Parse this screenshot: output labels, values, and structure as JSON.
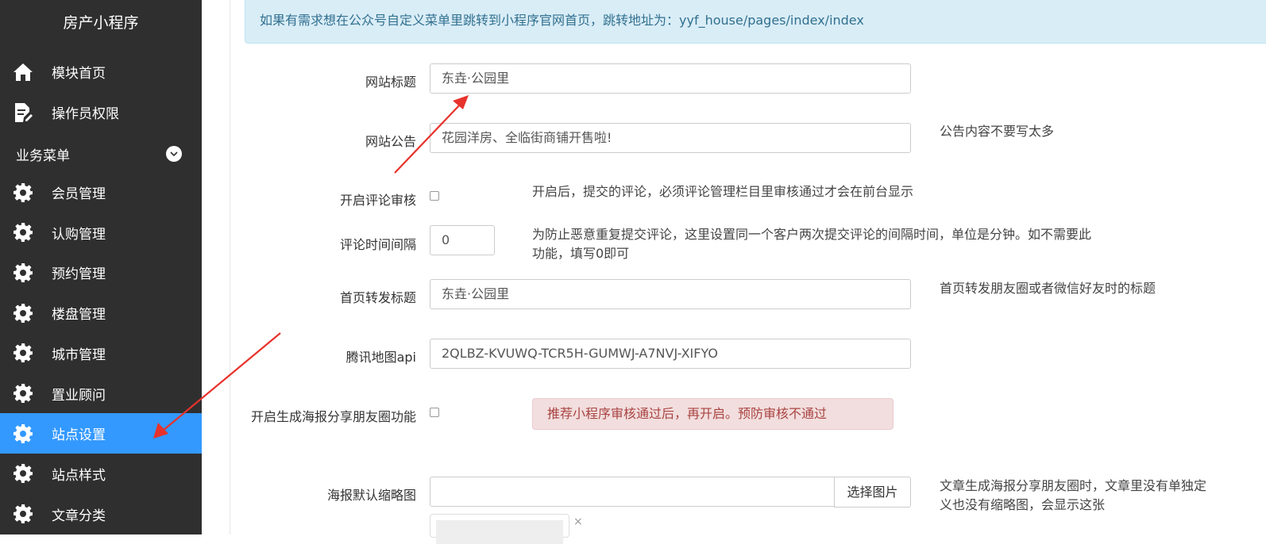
{
  "sidebar": {
    "brand": "房产小程序",
    "top_items": [
      {
        "label": "模块首页",
        "icon": "home-icon"
      },
      {
        "label": "操作员权限",
        "icon": "document-edit-icon"
      }
    ],
    "section": {
      "label": "业务菜单",
      "icon": "chevron-down-icon"
    },
    "items": [
      {
        "label": "会员管理",
        "icon": "gear-icon"
      },
      {
        "label": "认购管理",
        "icon": "gear-icon"
      },
      {
        "label": "预约管理",
        "icon": "gear-icon"
      },
      {
        "label": "楼盘管理",
        "icon": "gear-icon"
      },
      {
        "label": "城市管理",
        "icon": "gear-icon"
      },
      {
        "label": "置业顾问",
        "icon": "gear-icon"
      },
      {
        "label": "站点设置",
        "icon": "gear-icon",
        "active": true
      },
      {
        "label": "站点样式",
        "icon": "gear-icon"
      },
      {
        "label": "文章分类",
        "icon": "gear-icon"
      }
    ],
    "active_color": "#3399ff"
  },
  "notice": "如果有需求想在公众号自定义菜单里跳转到小程序官网首页，跳转地址为：yyf_house/pages/index/index",
  "form": {
    "site_title": {
      "label": "网站标题",
      "value": "东垚·公园里"
    },
    "site_notice": {
      "label": "网站公告",
      "value": "花园洋房、全临街商铺开售啦!",
      "help": "公告内容不要写太多"
    },
    "comment_review": {
      "label": "开启评论审核",
      "checked": false,
      "help": "开启后，提交的评论，必须评论管理栏目里审核通过才会在前台显示"
    },
    "comment_interval": {
      "label": "评论时间间隔",
      "value": "0",
      "help_line1": "为防止恶意重复提交评论，这里设置同一个客户两次提交评论的间隔时间，单位是分钟。如不需要此",
      "help_line2": "功能，填写0即可"
    },
    "share_title": {
      "label": "首页转发标题",
      "value": "东垚·公园里",
      "help": "首页转发朋友圈或者微信好友时的标题"
    },
    "map_api": {
      "label": "腾讯地图api",
      "value": "2QLBZ-KVUWQ-TCR5H-GUMWJ-A7NVJ-XIFYO"
    },
    "poster_share": {
      "label": "开启生成海报分享朋友圈功能",
      "checked": false,
      "warning": "推荐小程序审核通过后，再开启。预防审核不通过"
    },
    "poster_thumb": {
      "label": "海报默认缩略图",
      "value": "",
      "button": "选择图片",
      "help_line1": "文章生成海报分享朋友圈时，文章里没有单独定",
      "help_line2": "义也没有缩略图，会显示这张",
      "remove": "×"
    }
  },
  "annotation_color": "#e8322c"
}
